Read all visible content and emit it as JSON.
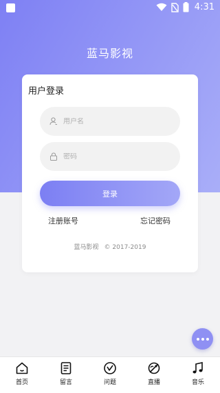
{
  "status_bar": {
    "time": "4:31"
  },
  "app": {
    "title": "蓝马影视"
  },
  "login": {
    "heading": "用户登录",
    "username_placeholder": "用户名",
    "password_placeholder": "密码",
    "login_label": "登录",
    "register_label": "注册账号",
    "forgot_label": "忘记密码",
    "footer_brand": "蓝马影视",
    "footer_copy": "© 2017-2019"
  },
  "tabbar": {
    "items": [
      {
        "label": "首页",
        "icon": "home-icon"
      },
      {
        "label": "留言",
        "icon": "message-icon"
      },
      {
        "label": "问题",
        "icon": "question-icon"
      },
      {
        "label": "直播",
        "icon": "live-icon"
      },
      {
        "label": "音乐",
        "icon": "music-icon"
      }
    ]
  },
  "colors": {
    "accent": "#7e80f4",
    "accent_light": "#a9aef8",
    "background": "#f2f2f4"
  }
}
